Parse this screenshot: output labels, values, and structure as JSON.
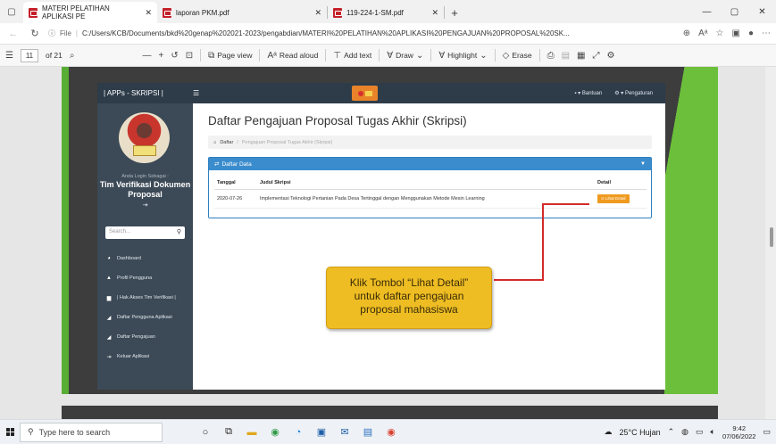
{
  "browser": {
    "tabs": [
      {
        "title": "MATERI PELATIHAN APLIKASI PE",
        "active": true
      },
      {
        "title": "laporan PKM.pdf",
        "active": false
      },
      {
        "title": "119-224-1-SM.pdf",
        "active": false
      }
    ],
    "new_tab": "+",
    "window_controls": {
      "minimize": "—",
      "restore": "▢",
      "close": "✕"
    },
    "address": {
      "info_label": "File",
      "url": "C:/Users/KCB/Documents/bkd%20genap%202021-2023/pengabdian/MATERI%20PELATIHAN%20APLIKASI%20PENGAJUAN%20PROPOSAL%20SK..."
    }
  },
  "pdf_toolbar": {
    "page_current": "11",
    "page_total": "of 21",
    "page_view": "Page view",
    "read_aloud": "Read aloud",
    "add_text": "Add text",
    "draw": "Draw",
    "highlight": "Highlight",
    "erase": "Erase"
  },
  "app": {
    "brand": "| APPs - SKRIPSI |",
    "top_right": {
      "help": "Bantuan",
      "settings": "Pengaturan"
    },
    "sidebar": {
      "login_as": "Anda Login Sebagai :",
      "user_name": "Tim Verifikasi Dokumen Proposal",
      "search_placeholder": "Search...",
      "menu": [
        {
          "label": "Dashboard",
          "icon": "dashboard-icon"
        },
        {
          "label": "Profil Pengguna",
          "icon": "user-icon"
        },
        {
          "label": "| Hak Akses Tim Verifikasi |",
          "icon": "list-icon"
        },
        {
          "label": "Daftar Pengguna Aplikasi",
          "icon": "book-icon"
        },
        {
          "label": "Daftar Pengajuan",
          "icon": "book-icon"
        },
        {
          "label": "Keluar Aplikasi",
          "icon": "logout-icon"
        }
      ]
    },
    "main": {
      "page_title": "Daftar Pengajuan Proposal Tugas Akhir (Skripsi)",
      "breadcrumb": {
        "home": "Daftar",
        "current": "Pengajuan Proposal Tugas Akhir (Skripsi)"
      },
      "panel_title": "Daftar Data",
      "table": {
        "headers": {
          "date": "Tanggal",
          "title": "Judul Skripsi",
          "detail": "Detail"
        },
        "rows": [
          {
            "date": "2020-07-26",
            "title": "Implementasi Teknologi Pertanian Pada Desa Tertinggal dengan Menggunakan Metode Mesin Learning",
            "detail_button": "Lihat Detail"
          }
        ]
      }
    }
  },
  "callout": {
    "line1": "Klik Tombol “Lihat Detail”",
    "line2": "untuk daftar pengajuan",
    "line3": "proposal mahasiswa"
  },
  "taskbar": {
    "search_placeholder": "Type here to search",
    "weather": "25°C  Hujan",
    "time": "9:42",
    "date": "07/06/2022"
  },
  "colors": {
    "accent_blue": "#3b8ccc",
    "callout_yellow": "#eebd23",
    "slide_green": "#6cbf3a",
    "app_dark": "#2e3c4a"
  }
}
